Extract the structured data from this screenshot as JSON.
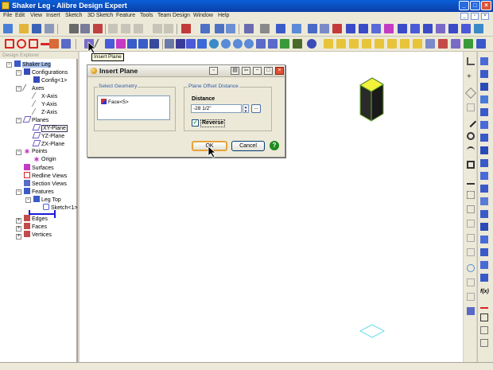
{
  "window": {
    "title": "Shaker Leg - Alibre Design Expert"
  },
  "menu": {
    "items": [
      "File",
      "Edit",
      "View",
      "Insert",
      "Sketch",
      "3D Sketch",
      "Feature",
      "Tools",
      "Team Design",
      "Window",
      "Help"
    ]
  },
  "tooltip": "Insert Plane",
  "explorer": {
    "header": "Design Explorer",
    "tree": [
      {
        "label": "Shaker Leg",
        "level": 0
      },
      {
        "label": "Configurations",
        "level": 1
      },
      {
        "label": "Config<1>",
        "level": 2
      },
      {
        "label": "Axes",
        "level": 1
      },
      {
        "label": "X-Axis",
        "level": 2
      },
      {
        "label": "Y-Axis",
        "level": 2
      },
      {
        "label": "Z-Axis",
        "level": 2
      },
      {
        "label": "Planes",
        "level": 1
      },
      {
        "label": "XY-Plane",
        "level": 2
      },
      {
        "label": "YZ-Plane",
        "level": 2
      },
      {
        "label": "ZX-Plane",
        "level": 2
      },
      {
        "label": "Points",
        "level": 1
      },
      {
        "label": "Origin",
        "level": 2
      },
      {
        "label": "Surfaces",
        "level": 1
      },
      {
        "label": "Redline Views",
        "level": 1
      },
      {
        "label": "Section Views",
        "level": 1
      },
      {
        "label": "Features",
        "level": 1
      },
      {
        "label": "Leg Top",
        "level": 2
      },
      {
        "label": "Sketch<1>",
        "level": 3
      },
      {
        "label": "Edges",
        "level": 1
      },
      {
        "label": "Faces",
        "level": 1
      },
      {
        "label": "Vertices",
        "level": 1
      }
    ]
  },
  "dialog": {
    "title": "Insert Plane",
    "select_geometry_label": "Select Geometry",
    "geometry_item": "Face<5>",
    "offset_group_label": "Plane Offset Distance",
    "distance_label": "Distance",
    "distance_value": "-28 1/2\"",
    "browse_label": "...",
    "reverse_label": "Reverse",
    "reverse_checked": true,
    "ok_label": "OK",
    "cancel_label": "Cancel",
    "help_label": "?"
  },
  "colors": {
    "titlebar": "#0b4fc8",
    "selection_highlight": "#adff2f",
    "plane_outline": "#6fdcf0"
  }
}
